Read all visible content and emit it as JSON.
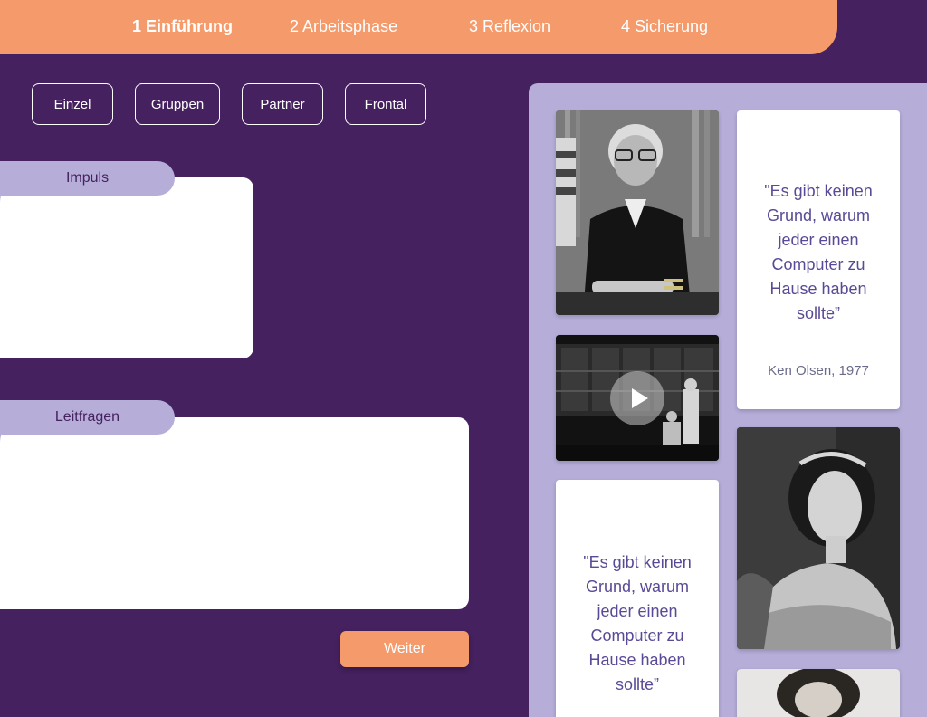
{
  "steps": [
    {
      "label": "1 Einführung",
      "active": true
    },
    {
      "label": "2 Arbeitsphase",
      "active": false
    },
    {
      "label": "3 Reflexion",
      "active": false
    },
    {
      "label": "4 Sicherung",
      "active": false
    }
  ],
  "modes": [
    "Einzel",
    "Gruppen",
    "Partner",
    "Frontal"
  ],
  "impuls": {
    "label": "Impuls"
  },
  "leitfragen": {
    "label": "Leitfragen"
  },
  "weiter_label": "Weiter",
  "gallery": {
    "quote_1": {
      "text": "\"Es gibt keinen Grund, warum jeder einen Computer zu Hause haben sollte”",
      "author": "Ken Olsen, 1977"
    },
    "quote_2": {
      "text": "\"Es gibt keinen Grund, warum jeder einen Computer zu Hause haben sollte”"
    }
  },
  "colors": {
    "background": "#45215f",
    "accent": "#f59a6a",
    "panel_lilac": "#b6aed9",
    "quote_text": "#5a4a96"
  },
  "icons": {
    "play": "play-icon"
  }
}
